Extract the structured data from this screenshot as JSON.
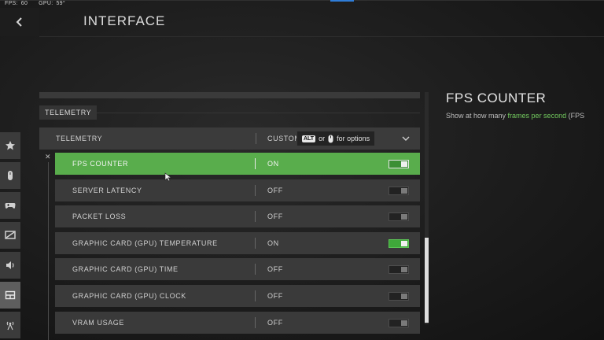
{
  "fps_overlay": {
    "fps_label": "FPS:",
    "fps_value": "60",
    "gpu_label": "GPU:",
    "gpu_value": "59°"
  },
  "header": {
    "title": "INTERFACE",
    "back_icon": "chevron-left-icon"
  },
  "sidebar": {
    "tabs": [
      {
        "icon": "star-icon"
      },
      {
        "icon": "controller-icon"
      },
      {
        "icon": "gamepad-icon"
      },
      {
        "icon": "display-icon"
      },
      {
        "icon": "speaker-icon"
      },
      {
        "icon": "interface-icon",
        "active": true
      },
      {
        "icon": "network-icon"
      }
    ]
  },
  "section": {
    "label": "TELEMETRY"
  },
  "telemetry_dropdown": {
    "label": "TELEMETRY",
    "value": "CUSTOM"
  },
  "tooltip": {
    "key": "ALT",
    "or": "or",
    "suffix": "for options"
  },
  "rows": [
    {
      "label": "FPS COUNTER",
      "value": "ON",
      "on": true,
      "selected": true
    },
    {
      "label": "SERVER LATENCY",
      "value": "OFF",
      "on": false
    },
    {
      "label": "PACKET LOSS",
      "value": "OFF",
      "on": false
    },
    {
      "label": "GRAPHIC CARD (GPU) TEMPERATURE",
      "value": "ON",
      "on": true
    },
    {
      "label": "GRAPHIC CARD (GPU) TIME",
      "value": "OFF",
      "on": false
    },
    {
      "label": "GRAPHIC CARD (GPU) CLOCK",
      "value": "OFF",
      "on": false
    },
    {
      "label": "VRAM USAGE",
      "value": "OFF",
      "on": false
    }
  ],
  "info_panel": {
    "title": "FPS COUNTER",
    "desc_prefix": "Show at how many ",
    "desc_highlight": "frames per second",
    "desc_suffix": " (FPS"
  },
  "colors": {
    "accent_green": "#59ad4c",
    "toggle_on": "#3fa83a",
    "highlight_text": "#72c95e"
  }
}
